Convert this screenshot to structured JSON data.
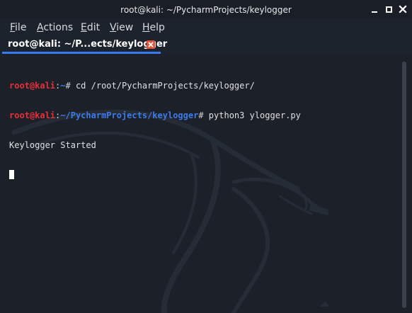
{
  "window": {
    "title": "root@kali: ~/PycharmProjects/keylogger"
  },
  "menu": {
    "items": [
      {
        "label_rest": "ile",
        "mnemonic": "F"
      },
      {
        "label_rest": "ctions",
        "mnemonic": "A"
      },
      {
        "label_rest": "dit",
        "mnemonic": "E"
      },
      {
        "label_rest": "iew",
        "mnemonic": "V"
      },
      {
        "label_rest": "elp",
        "mnemonic": "H"
      }
    ]
  },
  "tab": {
    "label": "root@kali: ~/P...ects/keylogger"
  },
  "terminal": {
    "lines": [
      {
        "user": "root@kali",
        "colon": ":",
        "path": "~",
        "hash": "# ",
        "command": "cd /root/PycharmProjects/keylogger/"
      },
      {
        "user": "root@kali",
        "colon": ":",
        "path": "~/PycharmProjects/keylogger",
        "hash": "# ",
        "command": "python3 ylogger.py"
      },
      {
        "output": "Keylogger Started"
      }
    ]
  },
  "colors": {
    "background": "#1b2029",
    "prompt_user": "#e8303a",
    "prompt_path": "#3d7be8",
    "tab_accent": "#367bf0",
    "tab_close": "#e2543c"
  }
}
